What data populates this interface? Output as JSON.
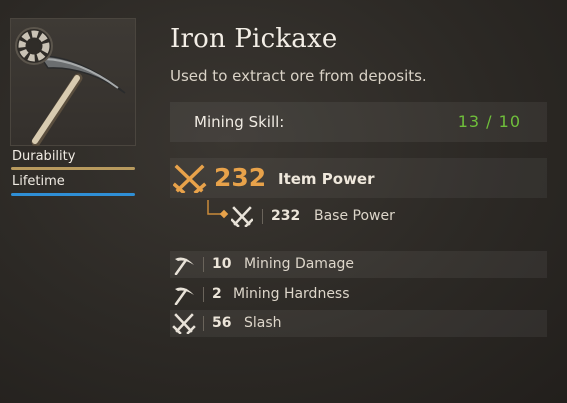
{
  "item": {
    "icon": "iron-pickaxe-icon",
    "name": "Iron Pickaxe",
    "description": "Used to extract ore from deposits."
  },
  "bars": {
    "durability": {
      "label": "Durability",
      "fraction": 1.0,
      "color": "#b89a5e"
    },
    "lifetime": {
      "label": "Lifetime",
      "fraction": 1.0,
      "color": "#2f8fd6"
    }
  },
  "requirement": {
    "label": "Mining Skill:",
    "value": "13 / 10",
    "value_color": "#6fbf3b"
  },
  "item_power": {
    "icon": "crossed-swords-icon",
    "value": "232",
    "label": "Item Power",
    "color": "#e8a24a"
  },
  "base_power": {
    "icon": "crossed-swords-icon",
    "value": "232",
    "label": "Base Power"
  },
  "stats": [
    {
      "icon": "pickaxe-icon",
      "value": "10",
      "label": "Mining Damage"
    },
    {
      "icon": "pickaxe-icon",
      "value": "2",
      "label": "Mining Hardness"
    },
    {
      "icon": "crossed-swords-icon",
      "value": "56",
      "label": "Slash"
    }
  ]
}
